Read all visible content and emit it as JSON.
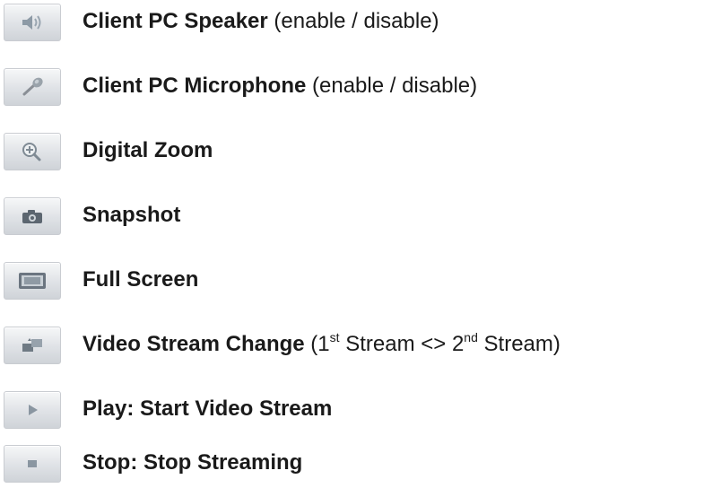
{
  "items": [
    {
      "icon": "speaker-icon",
      "bold": "Client PC Speaker",
      "suffix": " (enable / disable)"
    },
    {
      "icon": "microphone-icon",
      "bold": "Client PC Microphone",
      "suffix": " (enable / disable)"
    },
    {
      "icon": "zoom-icon",
      "bold": "Digital Zoom",
      "suffix": ""
    },
    {
      "icon": "camera-icon",
      "bold": "Snapshot",
      "suffix": ""
    },
    {
      "icon": "fullscreen-icon",
      "bold": "Full Screen",
      "suffix": ""
    },
    {
      "icon": "stream-change-icon",
      "bold": "Video Stream Change",
      "suffix": " (1",
      "sup1": "st",
      "mid": " Stream <> 2",
      "sup2": "nd",
      "end": " Stream)"
    },
    {
      "icon": "play-icon",
      "bold": "Play: Start Video Stream",
      "suffix": ""
    },
    {
      "icon": "stop-icon",
      "bold": "Stop: Stop Streaming",
      "suffix": ""
    }
  ]
}
